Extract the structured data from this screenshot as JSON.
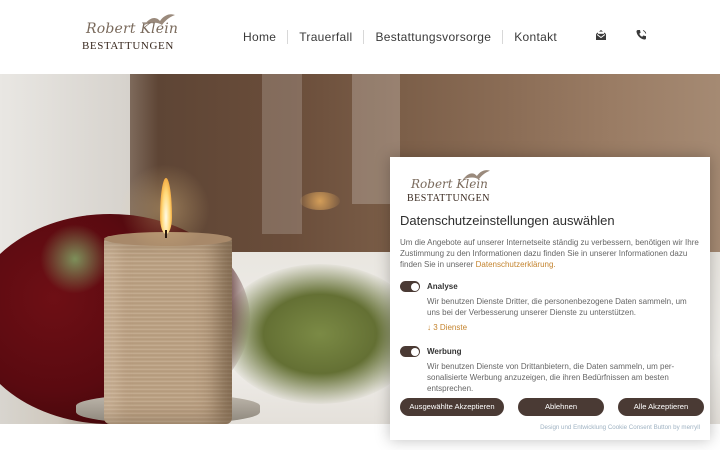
{
  "header": {
    "logo": {
      "script": "Robert Klein",
      "main": "BESTATTUNGEN"
    },
    "nav": [
      "Home",
      "Trauerfall",
      "Bestattungsvorsorge",
      "Kontakt"
    ],
    "icons": [
      "mail-icon",
      "phone-icon"
    ]
  },
  "cookie": {
    "logo": {
      "script": "Robert Klein",
      "main": "BESTATTUNGEN"
    },
    "title": "Datenschutzeinstellungen auswählen",
    "intro": "Um die Angebote auf unserer Internetseite ständig zu verbessern, benötigen wir Ihre Zustimmung zu den Informationen dazu finden Sie in unserer Informationen dazu finden Sie in unserer",
    "intro_link": "Datenschutzerklärung.",
    "categories": [
      {
        "label": "Analyse",
        "enabled": true,
        "desc": "Wir benutzen Dienste Dritter, die personenbezogene Daten sammeln, um uns bei der Verbesserung unserer Dienste zu unterstützen.",
        "services": "↓ 3 Dienste"
      },
      {
        "label": "Werbung",
        "enabled": true,
        "desc": "Wir benutzen Dienste von Drittanbietern, die Daten sammeln, um per-sonalisierte Werbung anzuzeigen, die ihren Bedürfnissen am besten entsprechen."
      }
    ],
    "buttons": {
      "selected": "Ausgewählte Akzeptieren",
      "reject": "Ablehnen",
      "accept_all": "Alle Akzeptieren"
    },
    "credit": "Design und Entwicklung Cookie Consent Button by merryll",
    "accent": "#c4842f",
    "button_color": "#4a3a34"
  }
}
